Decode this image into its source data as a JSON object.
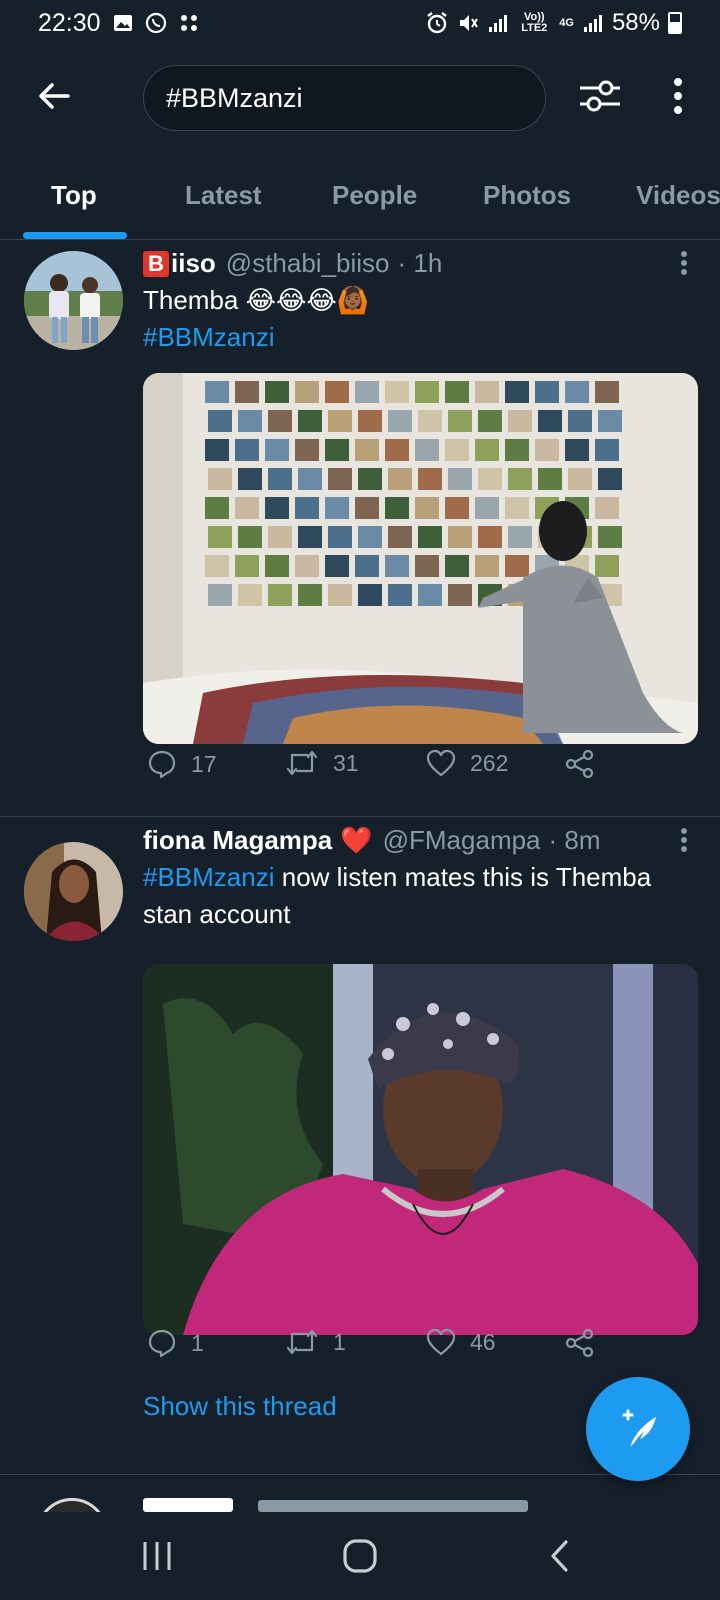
{
  "status_bar": {
    "time": "22:30",
    "battery_percent": "58%",
    "volte_label": "Vo)) LTE2",
    "network_label": "4G"
  },
  "search": {
    "query": "#BBMzanzi"
  },
  "tabs": [
    {
      "label": "Top",
      "active": true
    },
    {
      "label": "Latest",
      "active": false
    },
    {
      "label": "People",
      "active": false
    },
    {
      "label": "Photos",
      "active": false
    },
    {
      "label": "Videos",
      "active": false
    }
  ],
  "tweets": [
    {
      "display_name_badge": "B",
      "display_name": "iiso",
      "handle": "@sthabi_biiso",
      "time": "· 1h",
      "text": "Themba 😂😂😂🙆🏾",
      "hashtag": "#BBMzanzi",
      "replies": "17",
      "retweets": "31",
      "likes": "262"
    },
    {
      "display_name": "fiona Magampa",
      "name_emoji": "❤️",
      "handle": "@FMagampa",
      "time": "· 8m",
      "hashtag": "#BBMzanzi",
      "text": "now listen mates this is Themba stan account",
      "replies": "1",
      "retweets": "1",
      "likes": "46",
      "show_thread": "Show this thread"
    }
  ],
  "colors": {
    "background": "#15202b",
    "accent": "#1d9bf0",
    "secondary_text": "#8b98a5",
    "divider": "#38444d"
  }
}
